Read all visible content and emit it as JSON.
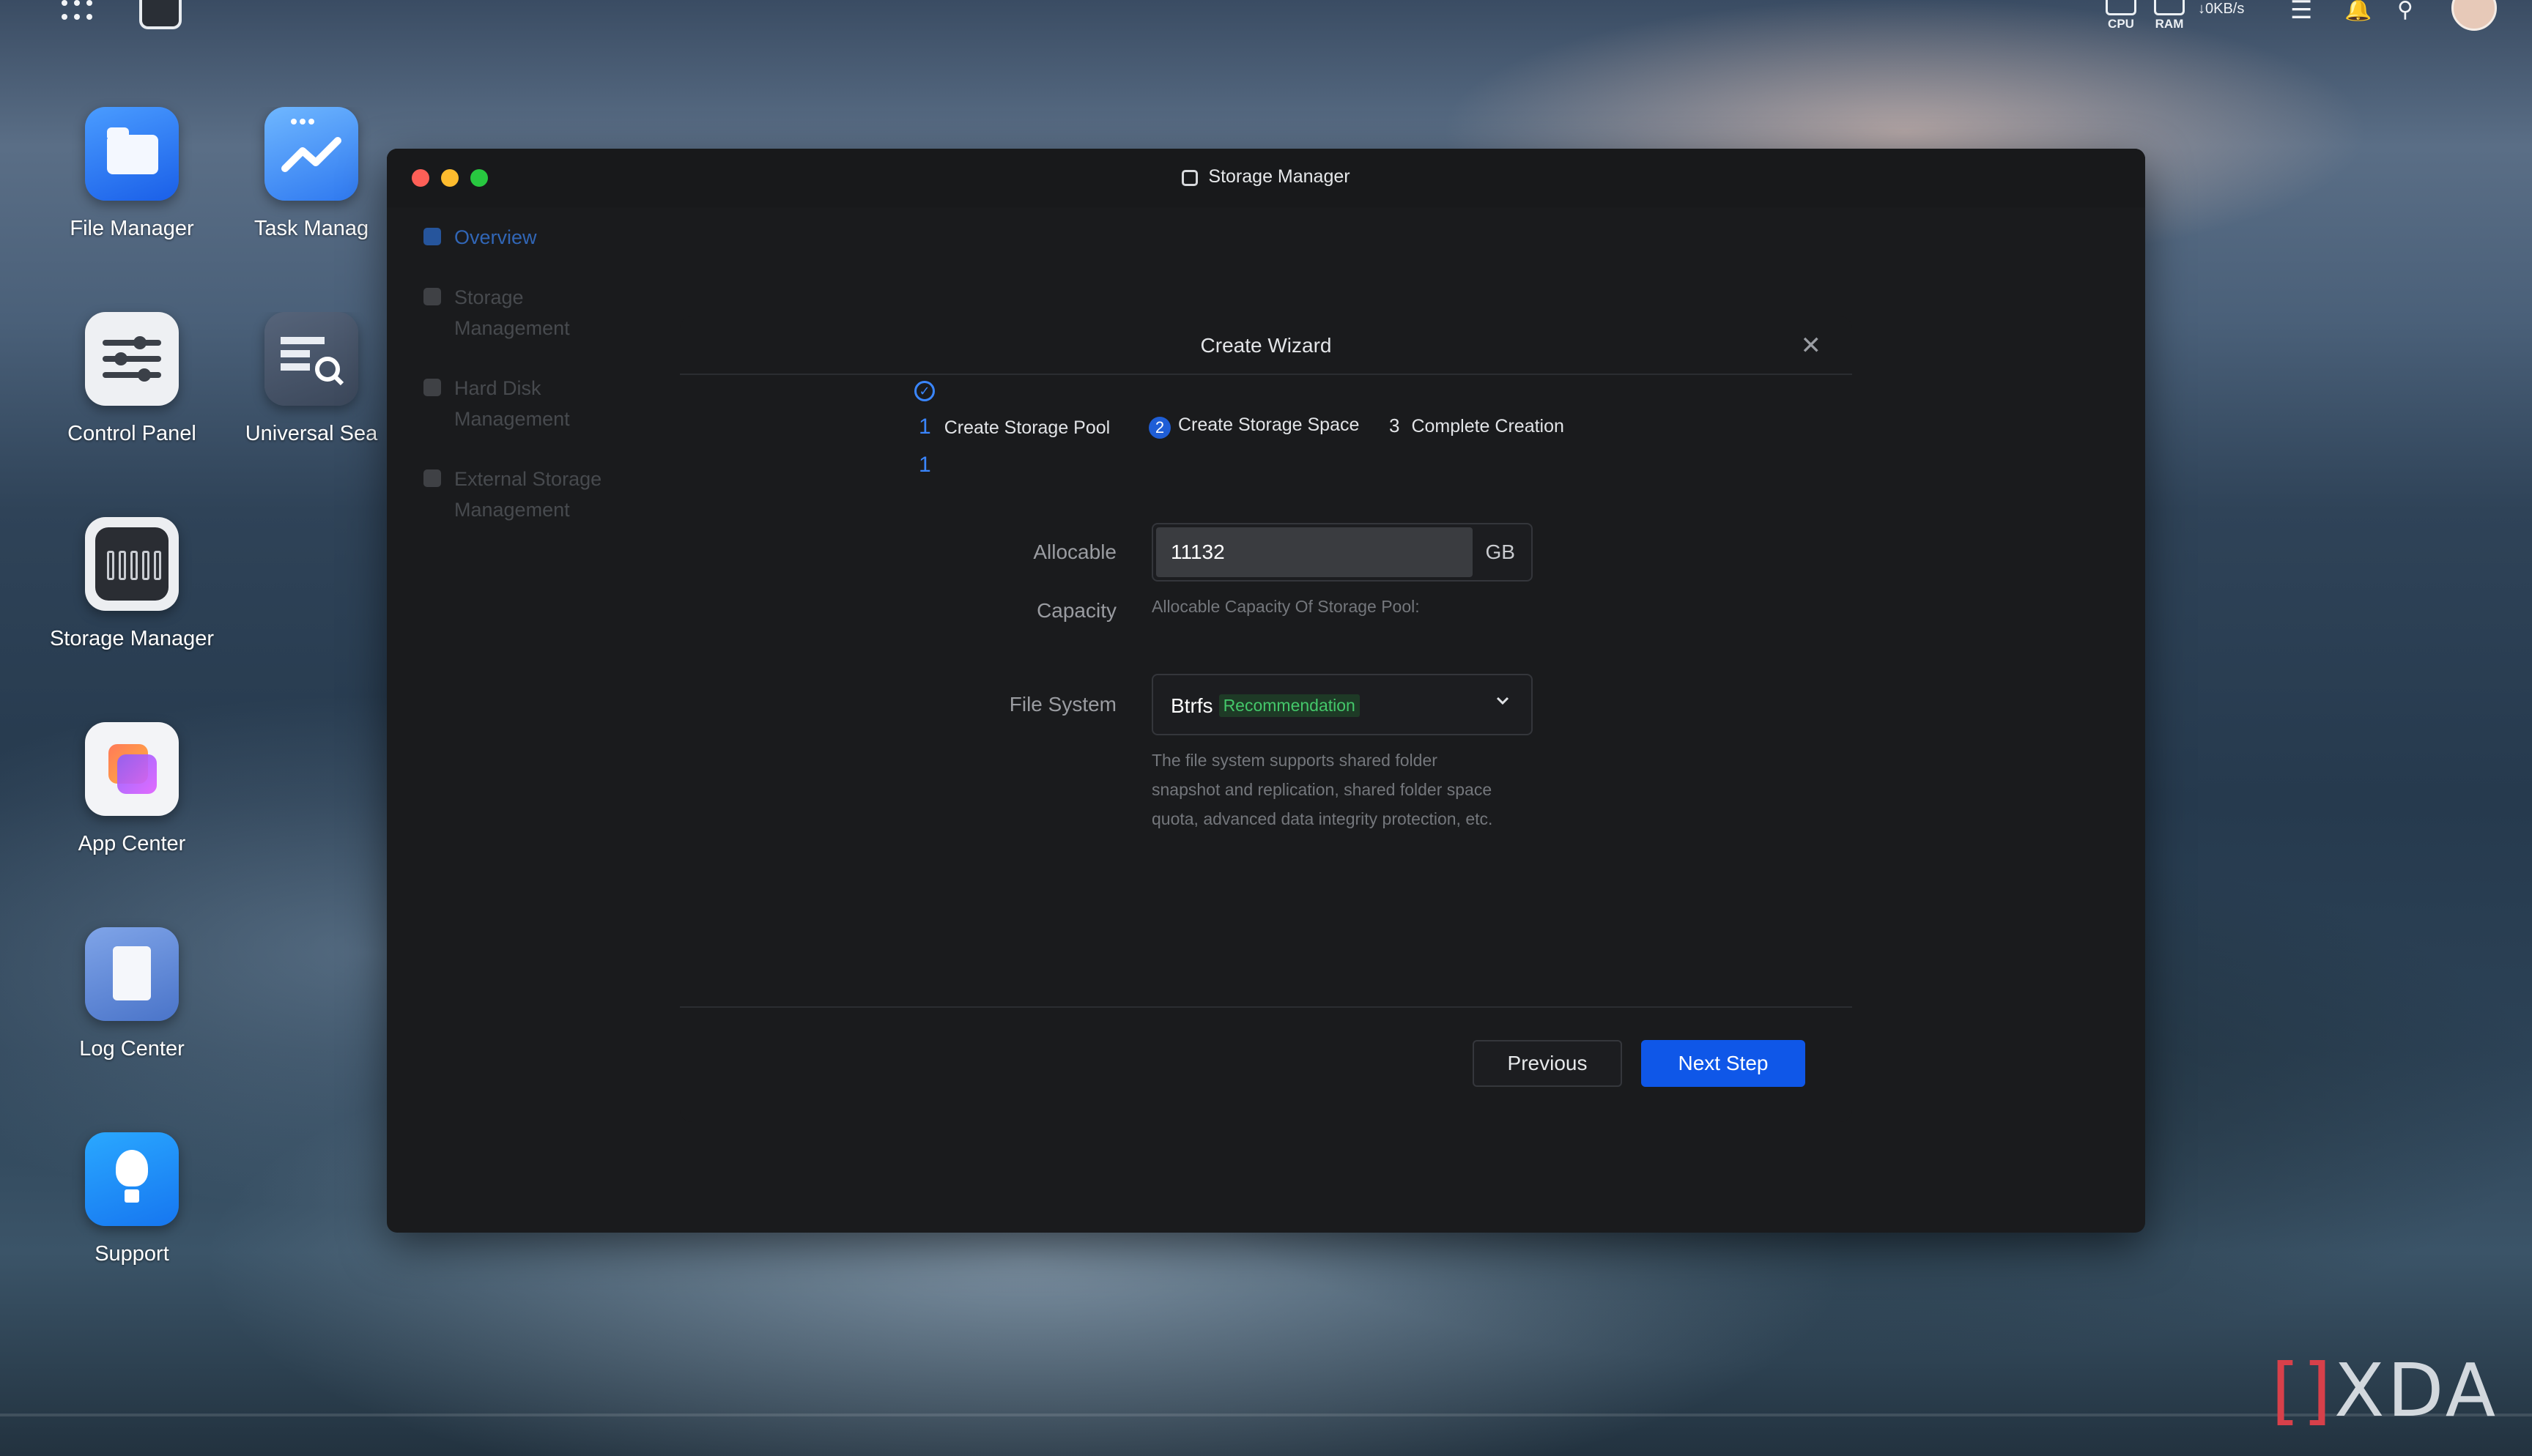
{
  "topbar": {
    "cpu_label": "CPU",
    "ram_label": "RAM",
    "net_speed": "↓0KB/s"
  },
  "desktop": {
    "icons": [
      {
        "label": "File Manager"
      },
      {
        "label": "Task Manag"
      },
      {
        "label": "Control Panel"
      },
      {
        "label": "Universal Sea"
      },
      {
        "label": "Storage Manager"
      },
      {
        "label": "App Center"
      },
      {
        "label": "Log Center"
      },
      {
        "label": "Support"
      }
    ]
  },
  "window": {
    "title": "Storage Manager",
    "sidebar": [
      {
        "line1": "Overview",
        "line2": ""
      },
      {
        "line1": "Storage",
        "line2": "Management"
      },
      {
        "line1": "Hard Disk",
        "line2": "Management"
      },
      {
        "line1": "External Storage",
        "line2": "Management"
      }
    ]
  },
  "wizard": {
    "title": "Create Wizard",
    "close_glyph": "✕",
    "steps": [
      {
        "num": "1",
        "label": "Create Storage Pool",
        "state": "done"
      },
      {
        "num": "2",
        "label": "Create Storage Space",
        "state": "current"
      },
      {
        "num": "3",
        "label": "Complete Creation",
        "state": "pending"
      }
    ],
    "step_sub": "1",
    "allocable_label_1": "Allocable",
    "allocable_label_2": "Capacity",
    "allocable_value": "11132",
    "allocable_unit": "GB",
    "allocable_hint": "Allocable Capacity Of Storage Pool:",
    "fs_label": "File System",
    "fs_value": "Btrfs",
    "fs_badge": "Recommendation",
    "fs_hint_1": "The file system supports shared folder",
    "fs_hint_2": "snapshot and replication, shared folder space",
    "fs_hint_3": "quota, advanced data integrity protection, etc.",
    "btn_previous": "Previous",
    "btn_next": "Next Step"
  },
  "watermark": {
    "text": "XDA"
  },
  "colors": {
    "accent": "#0f57e8",
    "link_blue": "#3a86ff",
    "recommend_green": "#44c76a"
  }
}
